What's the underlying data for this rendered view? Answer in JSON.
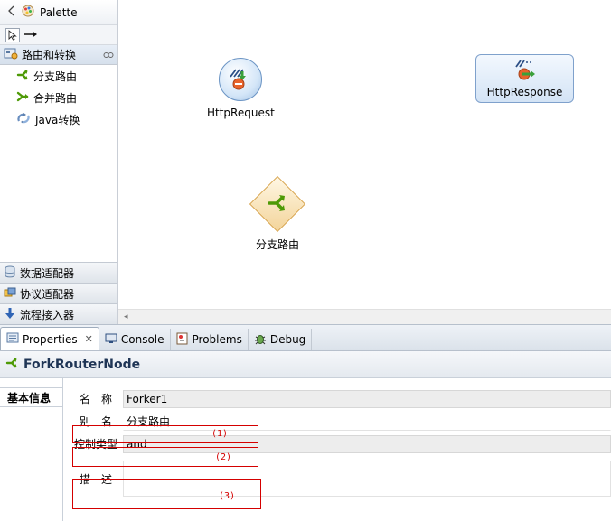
{
  "palette": {
    "title": "Palette",
    "open_drawer": "路由和转换",
    "items": [
      {
        "label": "分支路由"
      },
      {
        "label": "合并路由"
      },
      {
        "label": "Java转换"
      }
    ],
    "bottom_drawers": [
      {
        "label": "数据适配器"
      },
      {
        "label": "协议适配器"
      },
      {
        "label": "流程接入器"
      }
    ]
  },
  "canvas": {
    "nodes": {
      "request": "HttpRequest",
      "response": "HttpResponse",
      "fork": "分支路由"
    }
  },
  "tabs": [
    {
      "label": "Properties",
      "active": true
    },
    {
      "label": "Console"
    },
    {
      "label": "Problems"
    },
    {
      "label": "Debug"
    }
  ],
  "properties": {
    "title": "ForkRouterNode",
    "side_tab": "基本信息",
    "fields": {
      "name_label": "名　称",
      "name_value": "Forker1",
      "alias_label": "别　名",
      "alias_value": "分支路由",
      "control_label": "控制类型",
      "control_value": "and",
      "desc_label": "描　述",
      "desc_value": ""
    },
    "annotations": [
      "(1)",
      "(2)",
      "(3)"
    ]
  },
  "colors": {
    "annotation_red": "#d40000",
    "fork_green": "#4e9a06"
  }
}
